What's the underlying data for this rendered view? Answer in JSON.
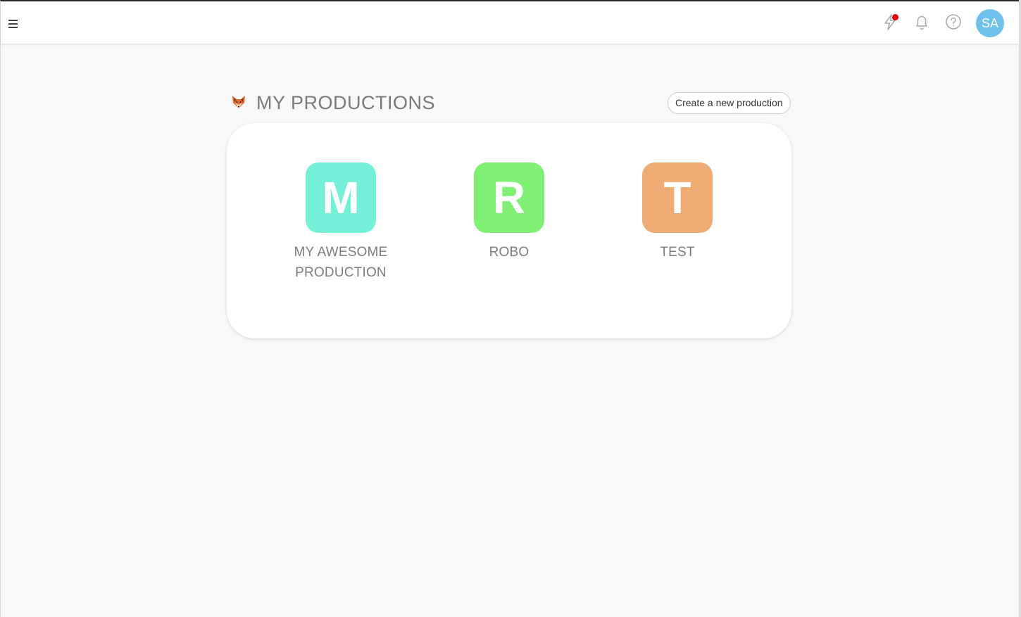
{
  "topbar": {
    "icons": [
      "menu-icon",
      "lightning-icon",
      "bell-icon",
      "help-icon"
    ],
    "notification_dot_color": "#e30000",
    "avatar_initials": "SA",
    "avatar_color": "#6ec1ec"
  },
  "main": {
    "title": "MY PRODUCTIONS",
    "title_icon": "fox-icon",
    "create_button_label": "Create a new production",
    "productions": [
      {
        "initial": "M",
        "name": "MY AWESOME PRODUCTION",
        "color": "#74f0d8"
      },
      {
        "initial": "R",
        "name": "ROBO",
        "color": "#80f074"
      },
      {
        "initial": "T",
        "name": "TEST",
        "color": "#eeab74"
      }
    ]
  }
}
